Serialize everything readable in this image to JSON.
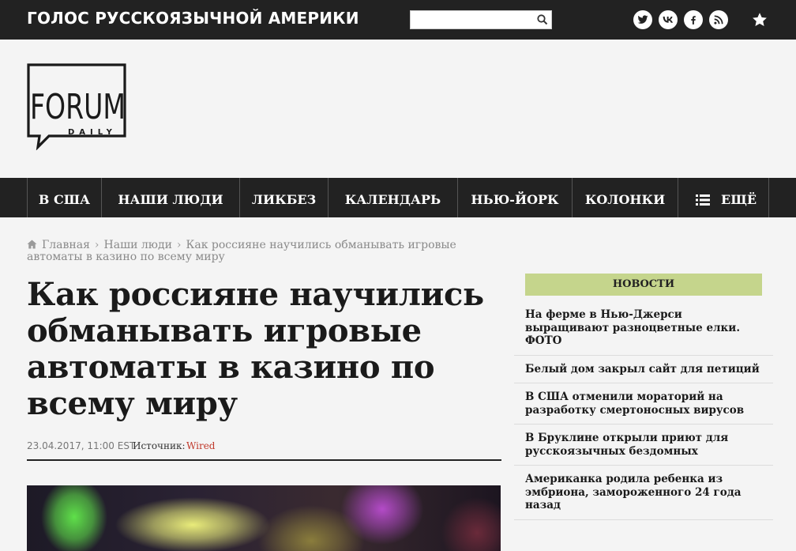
{
  "topbar": {
    "slogan": "ГОЛОС РУССКОЯЗЫЧНОЙ АМЕРИКИ",
    "search": {
      "value": "",
      "placeholder": ""
    },
    "social_icons": [
      "twitter-icon",
      "vk-icon",
      "facebook-icon",
      "rss-icon"
    ],
    "bookmark_icon": "star-icon"
  },
  "logo": {
    "word": "FORUM",
    "subword": "DAILY"
  },
  "nav": {
    "items": [
      {
        "label": "В США"
      },
      {
        "label": "НАШИ ЛЮДИ"
      },
      {
        "label": "ЛИКБЕЗ"
      },
      {
        "label": "КАЛЕНДАРЬ"
      },
      {
        "label": "НЬЮ-ЙОРК"
      },
      {
        "label": "КОЛОНКИ"
      }
    ],
    "more_label": "ЕЩЁ"
  },
  "breadcrumb": {
    "home": "Главная",
    "section": "Наши люди",
    "current": "Как россияне научились обманывать игровые автоматы в казино по всему миру"
  },
  "article": {
    "title": "Как россияне научились обманывать игровые автоматы в казино по всему миру",
    "datetime": "23.04.2017, 11:00 EST",
    "source_label": "Источник:",
    "source": "Wired"
  },
  "sidebar": {
    "header": "НОВОСТИ",
    "news": [
      {
        "title": "На ферме в Нью-Джерси выращивают разноцветные елки. ФОТО"
      },
      {
        "title": "Белый дом закрыл сайт для петиций"
      },
      {
        "title": "В США отменили мораторий на разработку смертоносных вирусов"
      },
      {
        "title": "В Бруклине открыли приют для русскоязычных бездомных"
      },
      {
        "title": "Американка родила ребенка из эмбриона, замороженного 24 года назад"
      }
    ]
  },
  "colors": {
    "bar_background": "#222222",
    "page_background": "#f4f4f4",
    "news_header_background": "#c5d58c",
    "source_link": "#c0392b"
  }
}
